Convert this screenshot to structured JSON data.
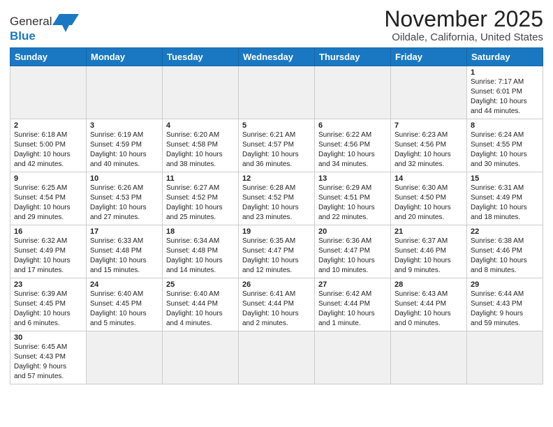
{
  "header": {
    "logo_general": "General",
    "logo_blue": "Blue",
    "title": "November 2025",
    "subtitle": "Oildale, California, United States"
  },
  "weekdays": [
    "Sunday",
    "Monday",
    "Tuesday",
    "Wednesday",
    "Thursday",
    "Friday",
    "Saturday"
  ],
  "weeks": [
    [
      {
        "day": "",
        "info": "",
        "empty": true
      },
      {
        "day": "",
        "info": "",
        "empty": true
      },
      {
        "day": "",
        "info": "",
        "empty": true
      },
      {
        "day": "",
        "info": "",
        "empty": true
      },
      {
        "day": "",
        "info": "",
        "empty": true
      },
      {
        "day": "",
        "info": "",
        "empty": true
      },
      {
        "day": "1",
        "info": "Sunrise: 7:17 AM\nSunset: 6:01 PM\nDaylight: 10 hours\nand 44 minutes."
      }
    ],
    [
      {
        "day": "2",
        "info": "Sunrise: 6:18 AM\nSunset: 5:00 PM\nDaylight: 10 hours\nand 42 minutes."
      },
      {
        "day": "3",
        "info": "Sunrise: 6:19 AM\nSunset: 4:59 PM\nDaylight: 10 hours\nand 40 minutes."
      },
      {
        "day": "4",
        "info": "Sunrise: 6:20 AM\nSunset: 4:58 PM\nDaylight: 10 hours\nand 38 minutes."
      },
      {
        "day": "5",
        "info": "Sunrise: 6:21 AM\nSunset: 4:57 PM\nDaylight: 10 hours\nand 36 minutes."
      },
      {
        "day": "6",
        "info": "Sunrise: 6:22 AM\nSunset: 4:56 PM\nDaylight: 10 hours\nand 34 minutes."
      },
      {
        "day": "7",
        "info": "Sunrise: 6:23 AM\nSunset: 4:56 PM\nDaylight: 10 hours\nand 32 minutes."
      },
      {
        "day": "8",
        "info": "Sunrise: 6:24 AM\nSunset: 4:55 PM\nDaylight: 10 hours\nand 30 minutes."
      }
    ],
    [
      {
        "day": "9",
        "info": "Sunrise: 6:25 AM\nSunset: 4:54 PM\nDaylight: 10 hours\nand 29 minutes."
      },
      {
        "day": "10",
        "info": "Sunrise: 6:26 AM\nSunset: 4:53 PM\nDaylight: 10 hours\nand 27 minutes."
      },
      {
        "day": "11",
        "info": "Sunrise: 6:27 AM\nSunset: 4:52 PM\nDaylight: 10 hours\nand 25 minutes."
      },
      {
        "day": "12",
        "info": "Sunrise: 6:28 AM\nSunset: 4:52 PM\nDaylight: 10 hours\nand 23 minutes."
      },
      {
        "day": "13",
        "info": "Sunrise: 6:29 AM\nSunset: 4:51 PM\nDaylight: 10 hours\nand 22 minutes."
      },
      {
        "day": "14",
        "info": "Sunrise: 6:30 AM\nSunset: 4:50 PM\nDaylight: 10 hours\nand 20 minutes."
      },
      {
        "day": "15",
        "info": "Sunrise: 6:31 AM\nSunset: 4:49 PM\nDaylight: 10 hours\nand 18 minutes."
      }
    ],
    [
      {
        "day": "16",
        "info": "Sunrise: 6:32 AM\nSunset: 4:49 PM\nDaylight: 10 hours\nand 17 minutes."
      },
      {
        "day": "17",
        "info": "Sunrise: 6:33 AM\nSunset: 4:48 PM\nDaylight: 10 hours\nand 15 minutes."
      },
      {
        "day": "18",
        "info": "Sunrise: 6:34 AM\nSunset: 4:48 PM\nDaylight: 10 hours\nand 14 minutes."
      },
      {
        "day": "19",
        "info": "Sunrise: 6:35 AM\nSunset: 4:47 PM\nDaylight: 10 hours\nand 12 minutes."
      },
      {
        "day": "20",
        "info": "Sunrise: 6:36 AM\nSunset: 4:47 PM\nDaylight: 10 hours\nand 10 minutes."
      },
      {
        "day": "21",
        "info": "Sunrise: 6:37 AM\nSunset: 4:46 PM\nDaylight: 10 hours\nand 9 minutes."
      },
      {
        "day": "22",
        "info": "Sunrise: 6:38 AM\nSunset: 4:46 PM\nDaylight: 10 hours\nand 8 minutes."
      }
    ],
    [
      {
        "day": "23",
        "info": "Sunrise: 6:39 AM\nSunset: 4:45 PM\nDaylight: 10 hours\nand 6 minutes."
      },
      {
        "day": "24",
        "info": "Sunrise: 6:40 AM\nSunset: 4:45 PM\nDaylight: 10 hours\nand 5 minutes."
      },
      {
        "day": "25",
        "info": "Sunrise: 6:40 AM\nSunset: 4:44 PM\nDaylight: 10 hours\nand 4 minutes."
      },
      {
        "day": "26",
        "info": "Sunrise: 6:41 AM\nSunset: 4:44 PM\nDaylight: 10 hours\nand 2 minutes."
      },
      {
        "day": "27",
        "info": "Sunrise: 6:42 AM\nSunset: 4:44 PM\nDaylight: 10 hours\nand 1 minute."
      },
      {
        "day": "28",
        "info": "Sunrise: 6:43 AM\nSunset: 4:44 PM\nDaylight: 10 hours\nand 0 minutes."
      },
      {
        "day": "29",
        "info": "Sunrise: 6:44 AM\nSunset: 4:43 PM\nDaylight: 9 hours\nand 59 minutes."
      }
    ],
    [
      {
        "day": "30",
        "info": "Sunrise: 6:45 AM\nSunset: 4:43 PM\nDaylight: 9 hours\nand 57 minutes."
      },
      {
        "day": "",
        "info": "",
        "empty": true
      },
      {
        "day": "",
        "info": "",
        "empty": true
      },
      {
        "day": "",
        "info": "",
        "empty": true
      },
      {
        "day": "",
        "info": "",
        "empty": true
      },
      {
        "day": "",
        "info": "",
        "empty": true
      },
      {
        "day": "",
        "info": "",
        "empty": true
      }
    ]
  ]
}
